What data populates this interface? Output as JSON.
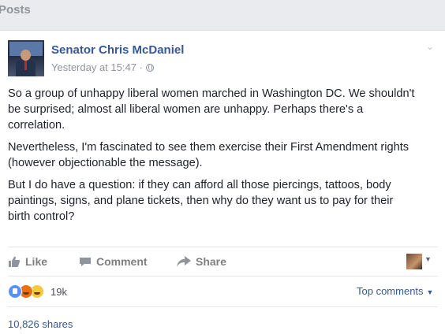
{
  "section": {
    "title": "Posts"
  },
  "post": {
    "author": "Senator Chris McDaniel",
    "timestamp": "Yesterday at 15:47 ·",
    "paragraphs": [
      "So a group of unhappy liberal women marched in Washington DC. We shouldn't be surprised; almost all liberal women are unhappy. Perhaps there's a correlation.",
      "Nevertheless, I'm fascinated to see them exercise their First Amendment rights (however objectionable the message).",
      "But I do have a question: if they can afford all those piercings, tattoos, body paintings, signs, and plane tickets, then why do they want us to pay for their birth control?"
    ]
  },
  "actions": {
    "like": "Like",
    "comment": "Comment",
    "share": "Share"
  },
  "reactions": {
    "icons": [
      "like-reaction-icon",
      "angry-reaction-icon",
      "haha-reaction-icon"
    ],
    "count": "19k"
  },
  "top_comments": "Top comments",
  "shares": "10,826 shares"
}
